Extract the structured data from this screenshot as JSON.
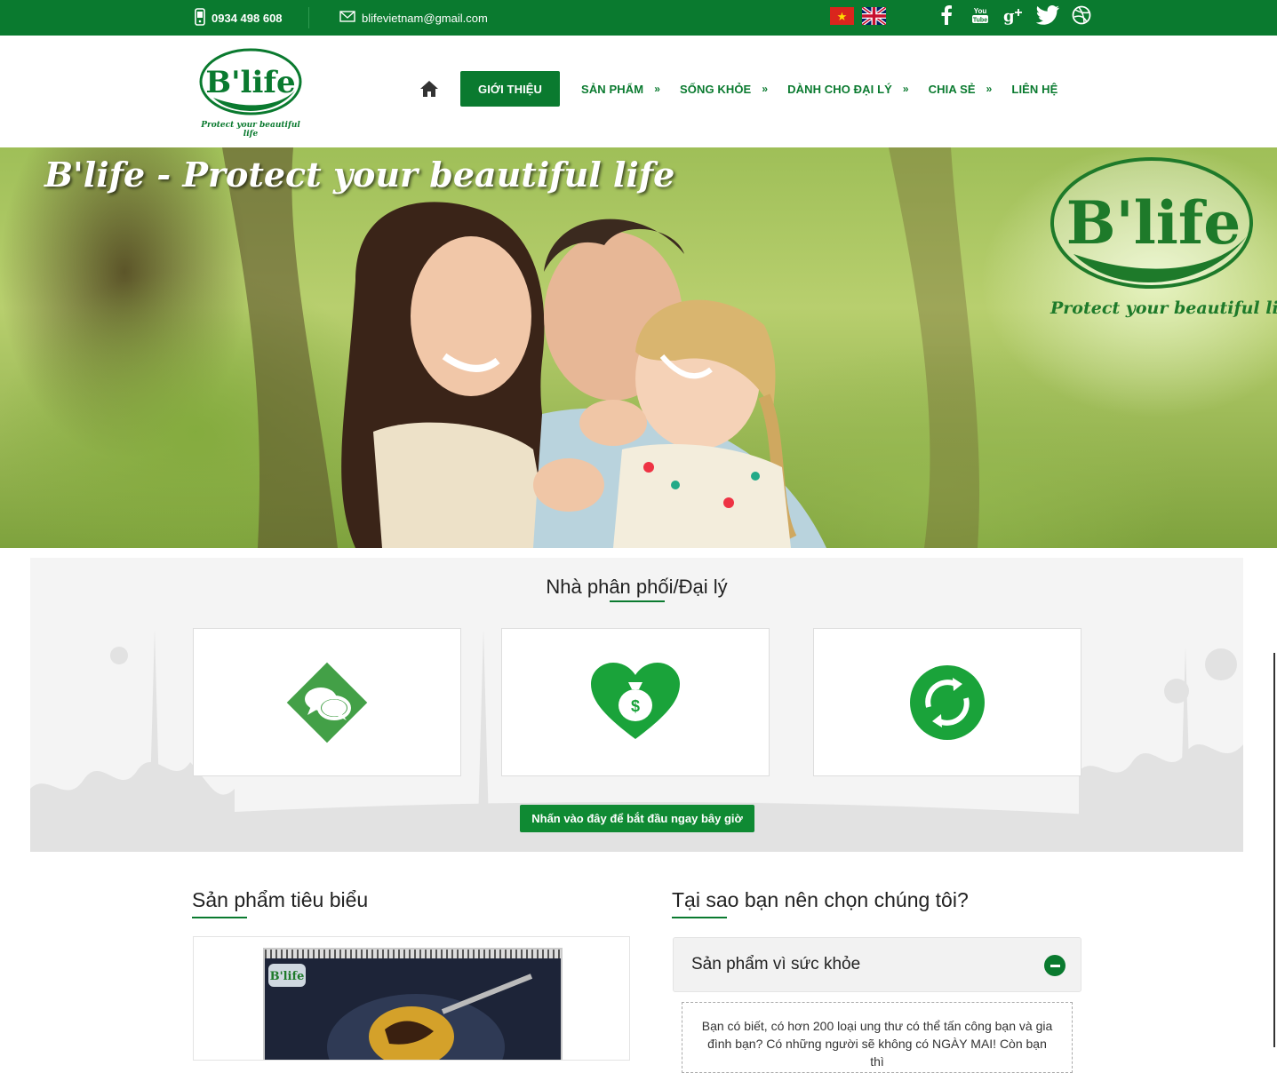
{
  "topbar": {
    "phone": "0934 498 608",
    "email": "blifevietnam@gmail.com",
    "flags": [
      "vietnam-flag",
      "uk-flag"
    ],
    "social": [
      {
        "name": "facebook-icon",
        "glyph": "f"
      },
      {
        "name": "youtube-icon",
        "glyph": "You"
      },
      {
        "name": "google-plus-icon",
        "glyph": "g+"
      },
      {
        "name": "twitter-icon",
        "glyph": "🐦"
      },
      {
        "name": "dribbble-icon",
        "glyph": "◎"
      }
    ],
    "bg_color": "#0a7a2f"
  },
  "header": {
    "logo_text": "B'life",
    "logo_tagline": "Protect your beautiful life",
    "nav": [
      {
        "label": "GIỚI THIỆU",
        "active": true,
        "arrow": ""
      },
      {
        "label": "SẢN PHẨM",
        "active": false,
        "arrow": "»"
      },
      {
        "label": "SỐNG KHỎE",
        "active": false,
        "arrow": "»"
      },
      {
        "label": "DÀNH CHO ĐẠI LÝ",
        "active": false,
        "arrow": "»"
      },
      {
        "label": "CHIA SẺ",
        "active": false,
        "arrow": "»"
      },
      {
        "label": "LIÊN HỆ",
        "active": false,
        "arrow": ""
      }
    ]
  },
  "hero": {
    "title": "B'life - Protect your beautiful life",
    "logo_text": "B'life",
    "logo_tagline": "Protect your beautiful life"
  },
  "distributor": {
    "title": "Nhà phân phối/Đại lý",
    "cards": [
      {
        "icon": "chat-bubbles-icon"
      },
      {
        "icon": "money-heart-icon"
      },
      {
        "icon": "recycle-icon"
      }
    ],
    "cta": "Nhấn vào đây để bắt đầu ngay bây giờ"
  },
  "featured": {
    "title": "Sản phẩm tiêu biểu",
    "image_logo": "B'life"
  },
  "why": {
    "title": "Tại sao bạn nên chọn chúng tôi?",
    "accordion_title": "Sản phẩm vì sức khỏe",
    "accordion_body": "Bạn có biết, có hơn 200 loại ung thư có thể tấn công bạn và gia đình bạn? Có những người sẽ không có NGÀY MAI! Còn bạn thì"
  },
  "colors": {
    "brand_green": "#0a7a2f",
    "cta_green": "#0f8a33",
    "icon_green": "#1aa33a"
  }
}
